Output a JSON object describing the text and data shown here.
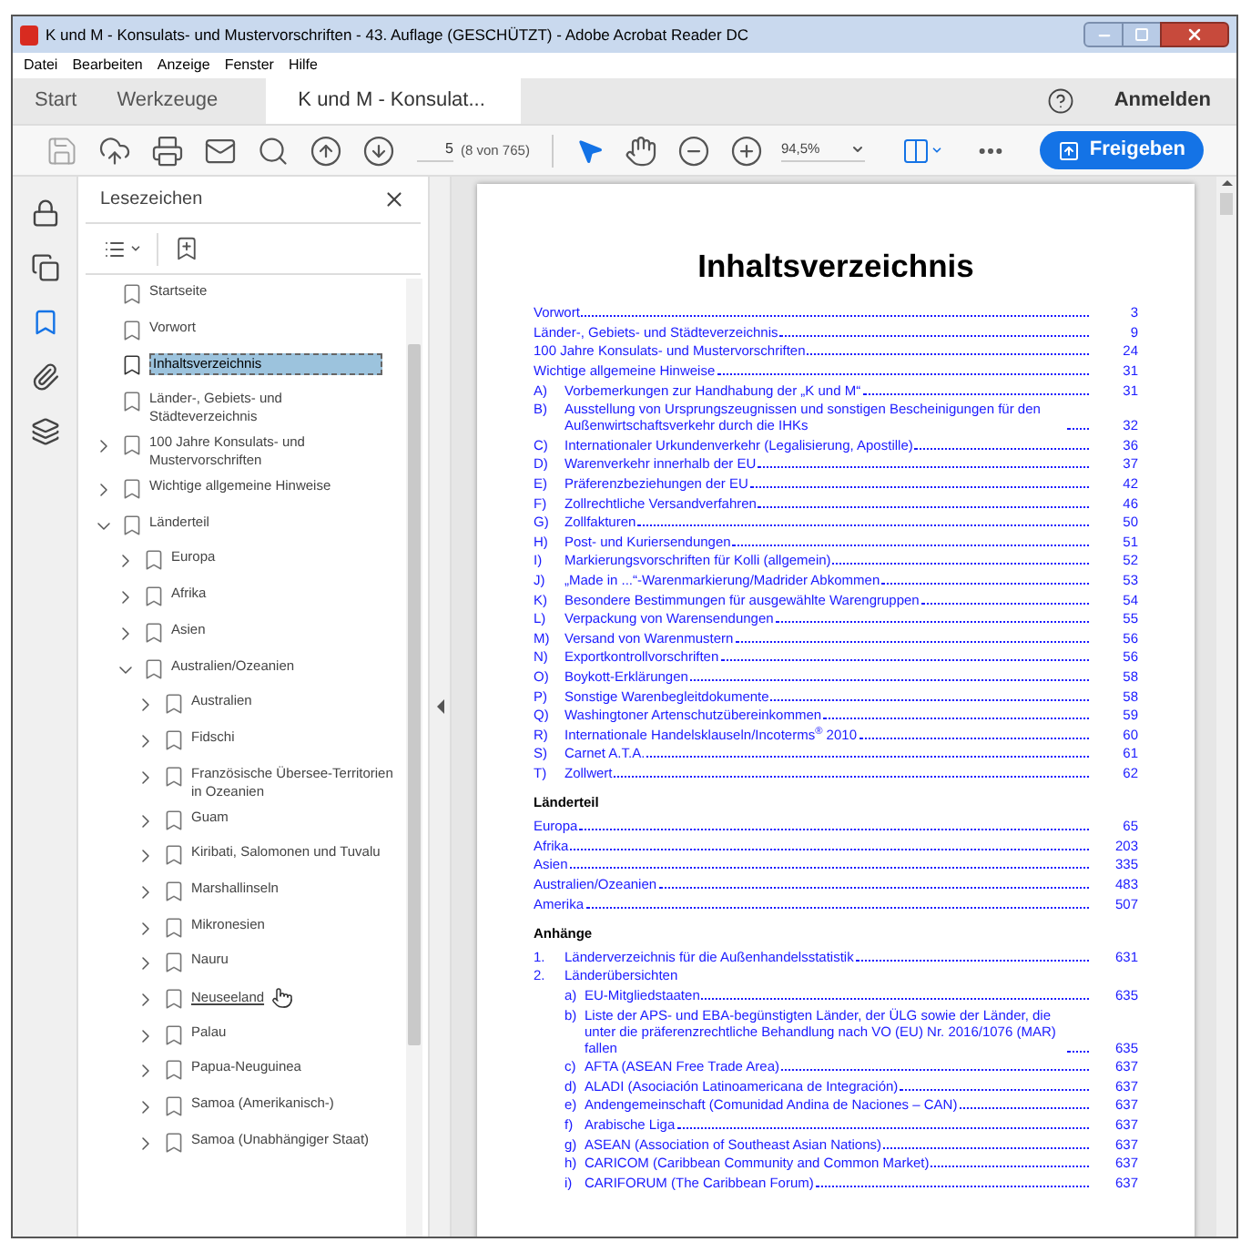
{
  "window": {
    "title": "K und M - Konsulats- und Mustervorschriften - 43. Auflage (GESCHÜTZT) - Adobe Acrobat Reader DC"
  },
  "menu": [
    "Datei",
    "Bearbeiten",
    "Anzeige",
    "Fenster",
    "Hilfe"
  ],
  "tabs": [
    {
      "label": "Start",
      "selected": false,
      "closable": false
    },
    {
      "label": "Werkzeuge",
      "selected": false,
      "closable": false
    },
    {
      "label": "K und M - Konsulat...",
      "selected": true,
      "closable": true
    }
  ],
  "account": {
    "label": "Anmelden"
  },
  "toolbar": {
    "page": "5",
    "page_info": "(8 von 765)",
    "zoom": "94,5%",
    "share": "Freigeben"
  },
  "bookmarks": {
    "title": "Lesezeichen",
    "items": [
      {
        "text": "Startseite",
        "kind": "leaf",
        "selected": false,
        "hovered": false
      },
      {
        "text": "Vorwort",
        "kind": "leaf",
        "selected": false,
        "hovered": false
      },
      {
        "text": "Inhaltsverzeichnis",
        "kind": "leaf",
        "selected": true,
        "hovered": false
      },
      {
        "text": "Länder-, Gebiets- und Städteverzeichnis",
        "kind": "leaf",
        "selected": false,
        "hovered": false
      },
      {
        "text": "100 Jahre Konsulats- und Mustervorschriften",
        "kind": "branch",
        "expanded": false,
        "selected": false,
        "hovered": false
      },
      {
        "text": "Wichtige allgemeine Hinweise",
        "kind": "branch",
        "expanded": false,
        "selected": false,
        "hovered": false
      },
      {
        "text": "Länderteil",
        "kind": "branch",
        "expanded": true,
        "selected": false,
        "hovered": false,
        "children": [
          {
            "text": "Europa",
            "kind": "branch",
            "expanded": false,
            "selected": false,
            "hovered": false
          },
          {
            "text": "Afrika",
            "kind": "branch",
            "expanded": false,
            "selected": false,
            "hovered": false
          },
          {
            "text": "Asien",
            "kind": "branch",
            "expanded": false,
            "selected": false,
            "hovered": false
          },
          {
            "text": "Australien/Ozeanien",
            "kind": "branch",
            "expanded": true,
            "selected": false,
            "hovered": false,
            "children": [
              {
                "text": "Australien",
                "kind": "branch",
                "expanded": false,
                "selected": false,
                "hovered": false
              },
              {
                "text": "Fidschi",
                "kind": "branch",
                "expanded": false,
                "selected": false,
                "hovered": false
              },
              {
                "text": "Französische Übersee-Territorien in Ozeanien",
                "kind": "branch",
                "expanded": false,
                "selected": false,
                "hovered": false
              },
              {
                "text": "Guam",
                "kind": "branch",
                "expanded": false,
                "selected": false,
                "hovered": false
              },
              {
                "text": "Kiribati, Salomonen und Tuvalu",
                "kind": "branch",
                "expanded": false,
                "selected": false,
                "hovered": false
              },
              {
                "text": "Marshallinseln",
                "kind": "branch",
                "expanded": false,
                "selected": false,
                "hovered": false
              },
              {
                "text": "Mikronesien",
                "kind": "branch",
                "expanded": false,
                "selected": false,
                "hovered": false
              },
              {
                "text": "Nauru",
                "kind": "branch",
                "expanded": false,
                "selected": false,
                "hovered": false
              },
              {
                "text": "Neuseeland",
                "kind": "branch",
                "expanded": false,
                "selected": false,
                "hovered": true
              },
              {
                "text": "Palau",
                "kind": "branch",
                "expanded": false,
                "selected": false,
                "hovered": false
              },
              {
                "text": "Papua-Neuguinea",
                "kind": "branch",
                "expanded": false,
                "selected": false,
                "hovered": false
              },
              {
                "text": "Samoa (Amerikanisch-)",
                "kind": "branch",
                "expanded": false,
                "selected": false,
                "hovered": false
              },
              {
                "text": "Samoa (Unabhängiger Staat)",
                "kind": "branch",
                "expanded": false,
                "selected": false,
                "hovered": false
              }
            ]
          }
        ]
      }
    ]
  },
  "document": {
    "title": "Inhaltsverzeichnis",
    "blocks": [
      {
        "kind": "entry",
        "text": "Vorwort",
        "page": "3"
      },
      {
        "kind": "entry",
        "text": "Länder-, Gebiets- und Städteverzeichnis",
        "page": "9"
      },
      {
        "kind": "entry",
        "text": "100 Jahre Konsulats- und Mustervorschriften",
        "page": "24"
      },
      {
        "kind": "entry",
        "text": "Wichtige allgemeine Hinweise",
        "page": "31"
      },
      {
        "kind": "entry",
        "label": "A)",
        "text": "Vorbemerkungen zur Handhabung der „K und M“",
        "page": "31"
      },
      {
        "kind": "entry",
        "label": "B)",
        "text": "Ausstellung von Ursprungszeugnissen und sonstigen Bescheinigungen für den Außenwirtschaftsverkehr durch die IHKs",
        "page": "32"
      },
      {
        "kind": "entry",
        "label": "C)",
        "text": "Internationaler Urkundenverkehr (Legalisierung, Apostille)",
        "page": "36"
      },
      {
        "kind": "entry",
        "label": "D)",
        "text": "Warenverkehr innerhalb der EU",
        "page": "37"
      },
      {
        "kind": "entry",
        "label": "E)",
        "text": "Präferenzbeziehungen der EU",
        "page": "42"
      },
      {
        "kind": "entry",
        "label": "F)",
        "text": "Zollrechtliche Versandverfahren",
        "page": "46"
      },
      {
        "kind": "entry",
        "label": "G)",
        "text": "Zollfakturen",
        "page": "50"
      },
      {
        "kind": "entry",
        "label": "H)",
        "text": "Post- und Kuriersendungen",
        "page": "51"
      },
      {
        "kind": "entry",
        "label": "I)",
        "text": "Markierungsvorschriften für Kolli (allgemein)",
        "page": "52"
      },
      {
        "kind": "entry",
        "label": "J)",
        "text": "„Made in ...“-Warenmarkierung/Madrider Abkommen",
        "page": "53"
      },
      {
        "kind": "entry",
        "label": "K)",
        "text": "Besondere Bestimmungen für ausgewählte Warengruppen",
        "page": "54"
      },
      {
        "kind": "entry",
        "label": "L)",
        "text": "Verpackung von Warensendungen",
        "page": "55"
      },
      {
        "kind": "entry",
        "label": "M)",
        "text": "Versand von Warenmustern",
        "page": "56"
      },
      {
        "kind": "entry",
        "label": "N)",
        "text": "Exportkontrollvorschriften",
        "page": "56"
      },
      {
        "kind": "entry",
        "label": "O)",
        "text": "Boykott-Erklärungen",
        "page": "58"
      },
      {
        "kind": "entry",
        "label": "P)",
        "text": "Sonstige Warenbegleitdokumente",
        "page": "58"
      },
      {
        "kind": "entry",
        "label": "Q)",
        "text": "Washingtoner Artenschutzübereinkommen",
        "page": "59"
      },
      {
        "kind": "entry",
        "label": "R)",
        "text": "Internationale Handelsklauseln/Incoterms$^{®}$ 2010",
        "page": "60"
      },
      {
        "kind": "entry",
        "label": "S)",
        "text": "Carnet A.T.A.",
        "page": "61"
      },
      {
        "kind": "entry",
        "label": "T)",
        "text": "Zollwert",
        "page": "62"
      },
      {
        "kind": "heading",
        "text": "Länderteil"
      },
      {
        "kind": "entry",
        "text": "Europa",
        "page": "65"
      },
      {
        "kind": "entry",
        "text": "Afrika",
        "page": "203"
      },
      {
        "kind": "entry",
        "text": "Asien",
        "page": "335"
      },
      {
        "kind": "entry",
        "text": "Australien/Ozeanien",
        "page": "483"
      },
      {
        "kind": "entry",
        "text": "Amerika",
        "page": "507"
      },
      {
        "kind": "heading",
        "text": "Anhänge"
      },
      {
        "kind": "entry",
        "label": "1.",
        "text": "Länderverzeichnis für die Außenhandelsstatistik",
        "page": "631"
      },
      {
        "kind": "entry",
        "label": "2.",
        "text": "Länderübersichten",
        "children": [
          {
            "label": "a)",
            "text": "EU-Mitgliedstaaten",
            "page": "635"
          },
          {
            "label": "b)",
            "text": "Liste der APS- und EBA-begünstigten Länder, der ÜLG sowie der Länder, die unter die präferenzrechtliche Behandlung nach VO (EU) Nr. 2016/1076 (MAR) fallen",
            "page": "635"
          },
          {
            "label": "c)",
            "text": "AFTA (ASEAN Free Trade Area)",
            "page": "637"
          },
          {
            "label": "d)",
            "text": "ALADI (Asociación Latinoamericana de Integración)",
            "page": "637"
          },
          {
            "label": "e)",
            "text": "Andengemeinschaft (Comunidad Andina de Naciones – CAN)",
            "page": "637"
          },
          {
            "label": "f)",
            "text": "Arabische Liga",
            "page": "637"
          },
          {
            "label": "g)",
            "text": "ASEAN (Association of Southeast Asian Nations)",
            "page": "637"
          },
          {
            "label": "h)",
            "text": "CARICOM (Caribbean Community and Common Market)",
            "page": "637"
          },
          {
            "label": "i)",
            "text": "CARIFORUM (The Caribbean Forum)",
            "page": "637"
          }
        ]
      }
    ]
  }
}
